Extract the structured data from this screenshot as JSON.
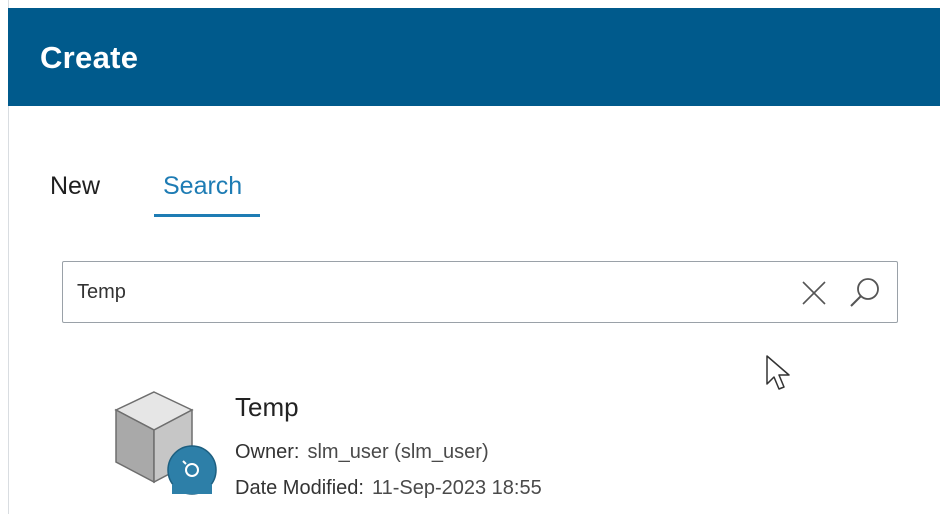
{
  "header": {
    "title": "Create"
  },
  "tabs": [
    {
      "label": "New",
      "active": false
    },
    {
      "label": "Search",
      "active": true
    }
  ],
  "search": {
    "value": "Temp",
    "clear_icon": "close-icon",
    "search_icon": "magnifier-icon"
  },
  "results": [
    {
      "title": "Temp",
      "icon": "template-cube-icon",
      "owner_label": "Owner:",
      "owner_value": "slm_user (slm_user)",
      "date_label": "Date Modified:",
      "date_value": "11-Sep-2023 18:55"
    }
  ],
  "colors": {
    "header_bg": "#005a8c",
    "accent": "#1e7cb4",
    "badge": "#2d7fa8"
  }
}
